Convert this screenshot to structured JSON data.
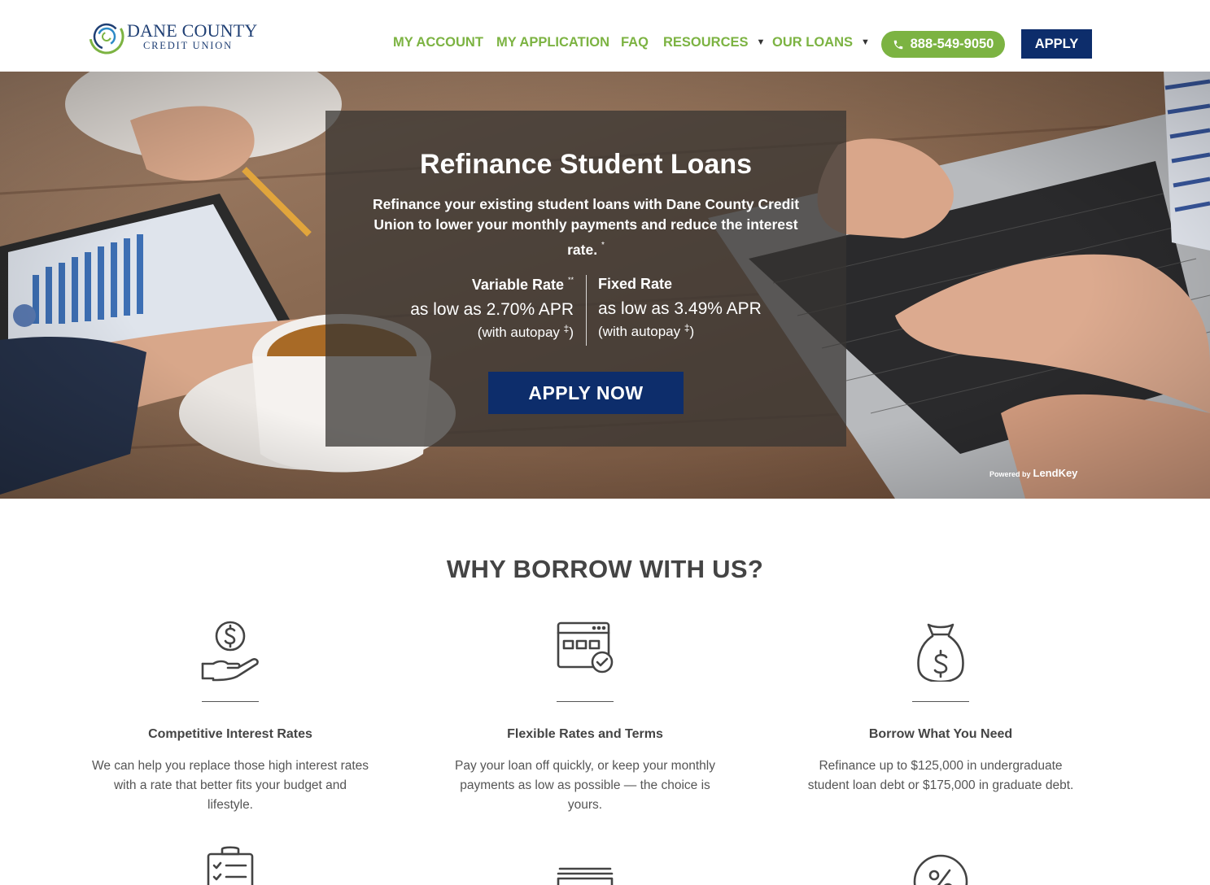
{
  "brand": {
    "name_line1": "DANE COUNTY",
    "name_line2": "CREDIT UNION",
    "colors": {
      "green": "#7cb342",
      "navy": "#0d2d6b",
      "logo_blue": "#1f3f74"
    }
  },
  "nav": {
    "my_account": "MY ACCOUNT",
    "my_application": "MY APPLICATION",
    "faq": "FAQ",
    "resources": "RESOURCES",
    "our_loans": "OUR LOANS",
    "phone": "888-549-9050",
    "apply": "APPLY"
  },
  "hero": {
    "title": "Refinance Student Loans",
    "subtitle": "Refinance your existing student loans with Dane County Credit Union to lower your monthly payments and reduce the interest rate.",
    "subtitle_mark": "*",
    "variable_label": "Variable Rate",
    "variable_mark": "**",
    "variable_value": "as low as 2.70% APR",
    "variable_note": "(with autopay",
    "fixed_label": "Fixed Rate",
    "fixed_value": "as low as 3.49% APR",
    "fixed_note": "(with autopay",
    "note_mark": "‡",
    "note_close": ")",
    "apply_now": "APPLY NOW",
    "powered_by": "Powered by",
    "powered_brand": "LendKey"
  },
  "why": {
    "title": "WHY BORROW WITH US?",
    "features": [
      {
        "icon": "money-hand-icon",
        "title": "Competitive Interest Rates",
        "desc": "We can help you replace those high interest rates with a rate that better fits your budget and lifestyle."
      },
      {
        "icon": "calendar-check-icon",
        "title": "Flexible Rates and Terms",
        "desc": "Pay your loan off quickly, or keep your monthly payments as low as possible — the choice is yours."
      },
      {
        "icon": "money-bag-icon",
        "title": "Borrow What You Need",
        "desc": "Refinance up to $125,000 in undergraduate student loan debt or $175,000 in graduate debt."
      }
    ],
    "more_icons": [
      "clipboard-checklist-icon",
      "cash-stack-icon",
      "percent-icon"
    ]
  }
}
